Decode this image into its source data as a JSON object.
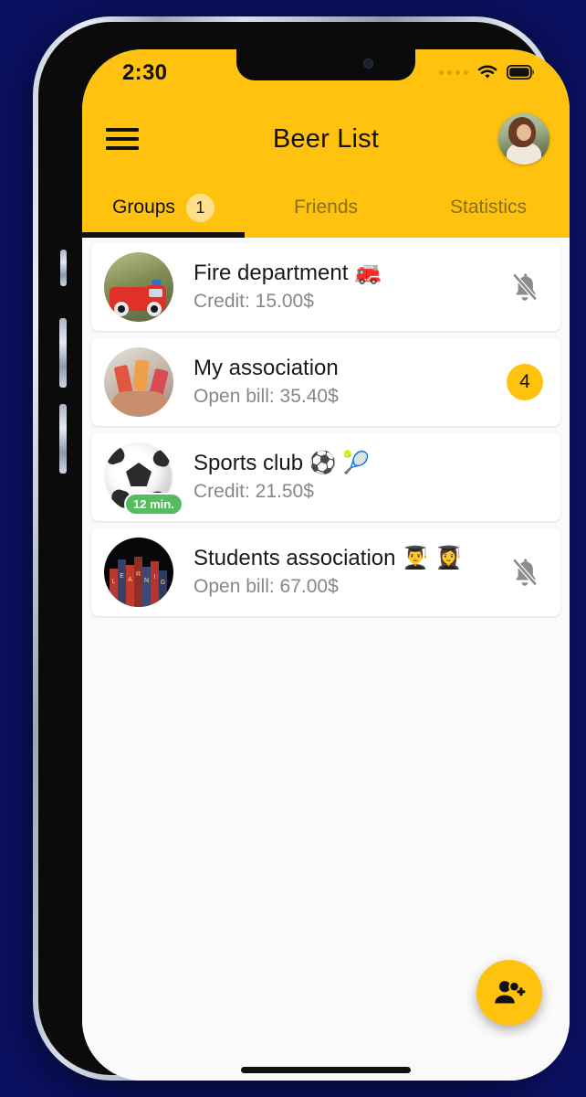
{
  "status_bar": {
    "time": "2:30",
    "signal_icon": "signal-dots-icon",
    "wifi_icon": "wifi-icon",
    "battery_icon": "battery-full-icon"
  },
  "header": {
    "title": "Beer List",
    "menu_icon": "hamburger-menu-icon",
    "avatar_name": "profile-avatar",
    "background_color": "#FFC20E"
  },
  "tabs": [
    {
      "label": "Groups",
      "badge": "1",
      "active": true
    },
    {
      "label": "Friends",
      "badge": "",
      "active": false
    },
    {
      "label": "Statistics",
      "badge": "",
      "active": false
    }
  ],
  "groups": [
    {
      "name": "Fire department 🚒",
      "subtitle": "Credit: 15.00$",
      "trailing_type": "bell-off",
      "trailing_value": "",
      "avatar": "fire-truck",
      "time_badge": ""
    },
    {
      "name": "My association",
      "subtitle": "Open bill: 35.40$",
      "trailing_type": "count",
      "trailing_value": "4",
      "avatar": "drinks-cheers",
      "time_badge": ""
    },
    {
      "name": "Sports club ⚽ 🎾",
      "subtitle": "Credit: 21.50$",
      "trailing_type": "none",
      "trailing_value": "",
      "avatar": "soccer-ball",
      "time_badge": "12 min."
    },
    {
      "name": "Students association 👨‍🎓 👩‍🎓",
      "subtitle": "Open bill: 67.00$",
      "trailing_type": "bell-off",
      "trailing_value": "",
      "avatar": "books",
      "time_badge": ""
    }
  ],
  "fab": {
    "icon": "person-add-icon",
    "color": "#FFC20E"
  },
  "colors": {
    "accent": "#FFC20E",
    "tab_badge": "#FFE08A",
    "time_badge": "#55BD5F",
    "page_background": "#FAFAFA",
    "card": "#FFFFFF",
    "outer_background": "#0A1060"
  },
  "home_indicator": "home-indicator"
}
